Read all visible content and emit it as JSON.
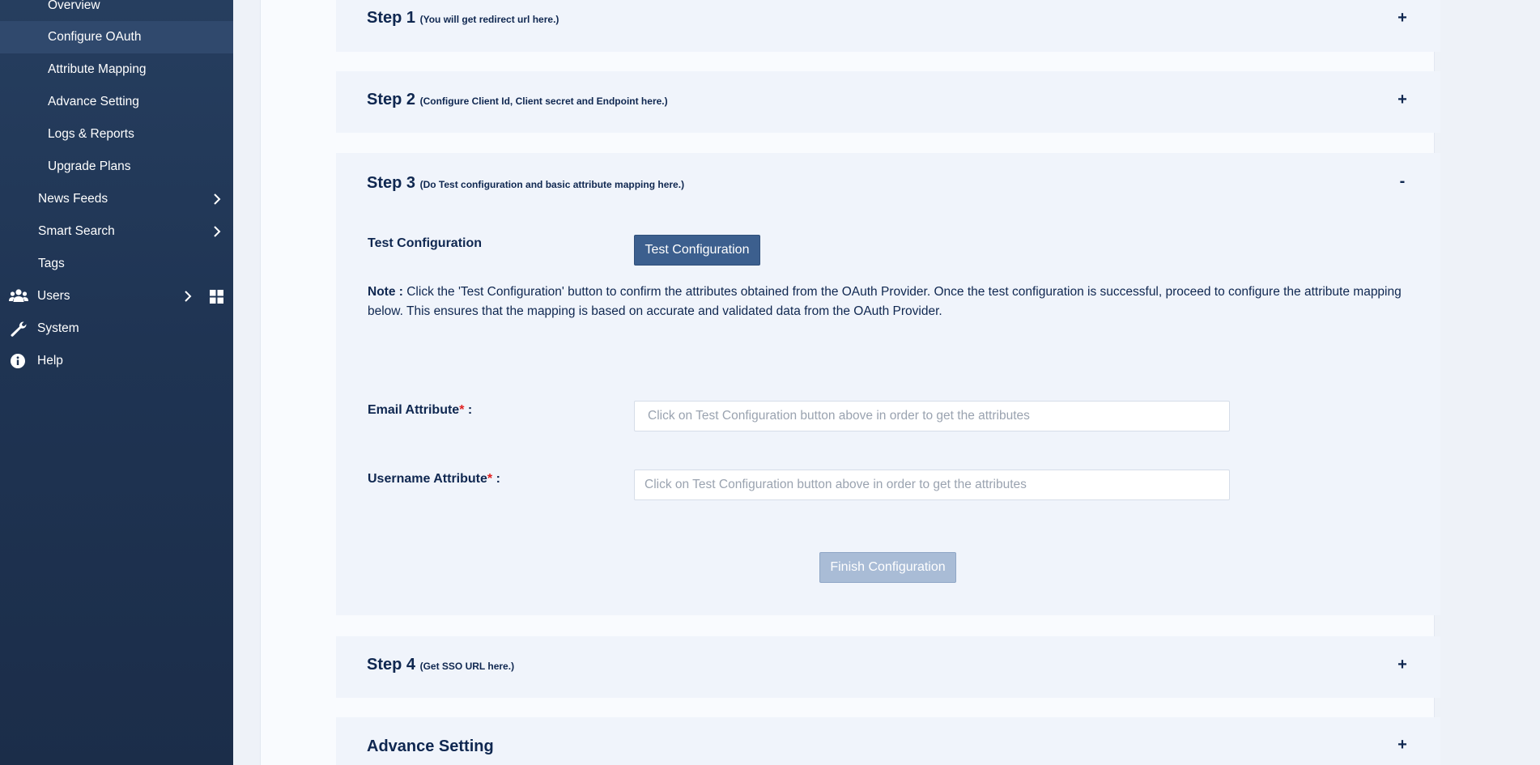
{
  "sidebar": {
    "items": [
      {
        "label": "Overview"
      },
      {
        "label": "Configure OAuth"
      },
      {
        "label": "Attribute Mapping"
      },
      {
        "label": "Advance Setting"
      },
      {
        "label": "Logs & Reports"
      },
      {
        "label": "Upgrade Plans"
      },
      {
        "label": "News Feeds"
      },
      {
        "label": "Smart Search"
      },
      {
        "label": "Tags"
      },
      {
        "label": "Users"
      },
      {
        "label": "System"
      },
      {
        "label": "Help"
      }
    ],
    "active_item": "Configure OAuth"
  },
  "steps": [
    {
      "title": "Step 1",
      "subtitle": "(You will get redirect url here.)",
      "toggle": "+"
    },
    {
      "title": "Step 2",
      "subtitle": "(Configure Client Id, Client secret and Endpoint here.)",
      "toggle": "+"
    },
    {
      "title": "Step 3",
      "subtitle": "(Do Test configuration and basic attribute mapping here.)",
      "toggle": "-"
    },
    {
      "title": "Step 4",
      "subtitle": "(Get SSO URL here.)",
      "toggle": "+"
    },
    {
      "title": "Advance Setting",
      "subtitle": "",
      "toggle": "+"
    }
  ],
  "step3": {
    "test_label": "Test Configuration",
    "test_button": "Test Configuration",
    "note_label": "Note :",
    "note_text": "Click the 'Test Configuration' button to confirm the attributes obtained from the OAuth Provider. Once the test configuration is successful, proceed to configure the attribute mapping below. This ensures that the mapping is based on accurate and validated data from the OAuth Provider.",
    "email_label": "Email Attribute",
    "username_label": "Username Attribute",
    "required_mark": "*",
    "colon": " :",
    "email_placeholder": "Click on Test Configuration button above in order to get the attributes",
    "username_placeholder": "Click on Test Configuration button above in order to get the attributes",
    "finish_button": "Finish Configuration"
  },
  "colors": {
    "sidebar_bg": "#1f3453",
    "sidebar_active": "#30496d",
    "heading": "#0f2750",
    "primary_button": "#3c5f8e",
    "disabled_button": "#a9bcd6",
    "required": "#e02020"
  }
}
